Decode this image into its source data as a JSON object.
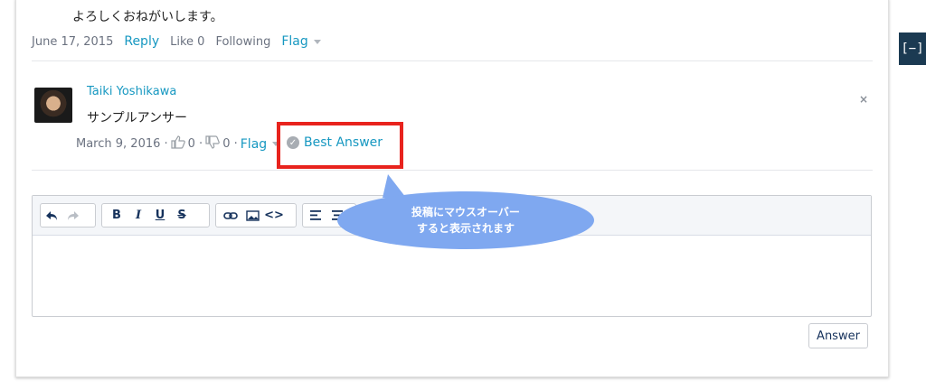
{
  "previous_post": {
    "text": "よろしくおねがいします。",
    "date": "June 17, 2015",
    "reply_label": "Reply",
    "like_label": "Like 0",
    "following_label": "Following",
    "flag_label": "Flag"
  },
  "answer": {
    "author": "Taiki Yoshikawa",
    "body": "サンプルアンサー",
    "date": "March 9, 2016 ·",
    "upvotes": "0 ·",
    "downvotes": "0 ·",
    "flag_label": "Flag",
    "best_answer_label": "Best Answer",
    "close_glyph": "×"
  },
  "annotation": {
    "line1": "投稿にマウスオーバー",
    "line2": "すると表示されます",
    "highlight_color": "#e8231d",
    "bubble_color": "#7fa8f0"
  },
  "editor": {
    "toolbar": {
      "undo": "↶",
      "redo": "↷",
      "bold": "B",
      "italic": "I",
      "underline": "U",
      "strikethrough": "S",
      "link_icon": "link-icon",
      "image_icon": "image-icon",
      "code": "<>",
      "align_left_icon": "align-left-icon"
    },
    "submit_label": "Answer"
  },
  "collapse_button": "[−]",
  "colors": {
    "link": "#1798c1",
    "sidebar_button": "#1b3a52"
  }
}
